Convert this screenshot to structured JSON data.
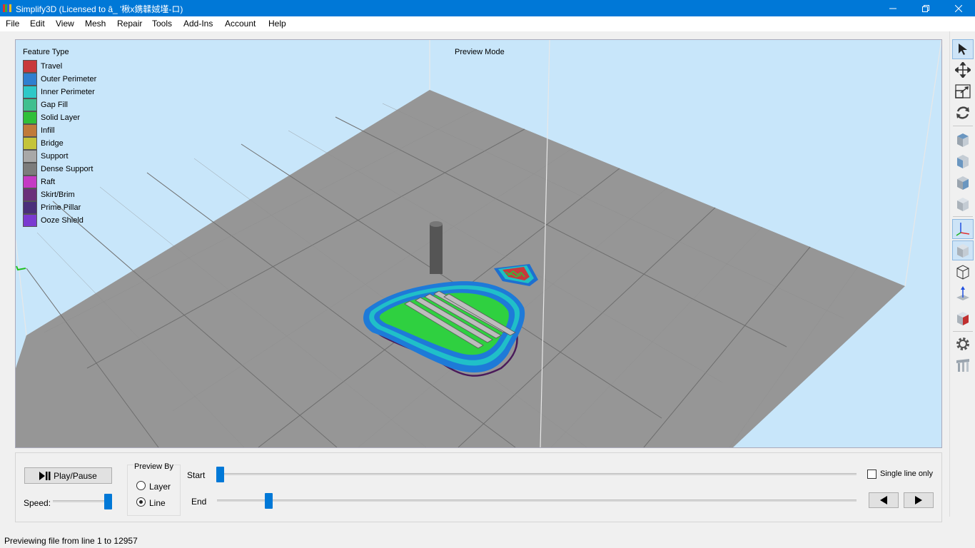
{
  "window": {
    "title": "Simplify3D (Licensed to â_ '楸x鎸韖娀墐-ロ)"
  },
  "menu": [
    "File",
    "Edit",
    "View",
    "Mesh",
    "Repair",
    "Tools",
    "Add-Ins",
    "Account",
    "Help"
  ],
  "viewport": {
    "legend_title": "Feature Type",
    "preview_mode_label": "Preview Mode",
    "legend": [
      {
        "label": "Travel",
        "color": "#c8393b"
      },
      {
        "label": "Outer Perimeter",
        "color": "#2f7fd0"
      },
      {
        "label": "Inner Perimeter",
        "color": "#2ec8c8"
      },
      {
        "label": "Gap Fill",
        "color": "#3fbf8f"
      },
      {
        "label": "Solid Layer",
        "color": "#2fbf3a"
      },
      {
        "label": "Infill",
        "color": "#c07a3a"
      },
      {
        "label": "Bridge",
        "color": "#c4c43a"
      },
      {
        "label": "Support",
        "color": "#a8a8a8"
      },
      {
        "label": "Dense Support",
        "color": "#7c7c7c"
      },
      {
        "label": "Raft",
        "color": "#c43ac4"
      },
      {
        "label": "Skirt/Brim",
        "color": "#6a2f7a"
      },
      {
        "label": "Prime Pillar",
        "color": "#4a2f7a"
      },
      {
        "label": "Ooze Shield",
        "color": "#7a3ad0"
      }
    ]
  },
  "controls": {
    "play_pause_label": "Play/Pause",
    "speed_label": "Speed:",
    "speed_value": 1.0,
    "preview_by_title": "Preview By",
    "preview_by_options": [
      "Layer",
      "Line"
    ],
    "preview_by_selected": "Line",
    "start_label": "Start",
    "end_label": "End",
    "start_value": 0.0,
    "end_value": 0.08,
    "single_line_label": "Single line only",
    "single_line_checked": false
  },
  "status": {
    "text": "Previewing file from line 1 to 12957"
  },
  "toolbar_icons": [
    "select-arrow-icon",
    "move-icon",
    "scale-icon",
    "rotate-icon",
    "view-top-icon",
    "view-front-icon",
    "view-side-icon",
    "view-iso-icon",
    "axes-icon",
    "solid-cube-icon",
    "wireframe-cube-icon",
    "normals-icon",
    "cross-section-icon",
    "settings-gear-icon",
    "supports-icon"
  ]
}
